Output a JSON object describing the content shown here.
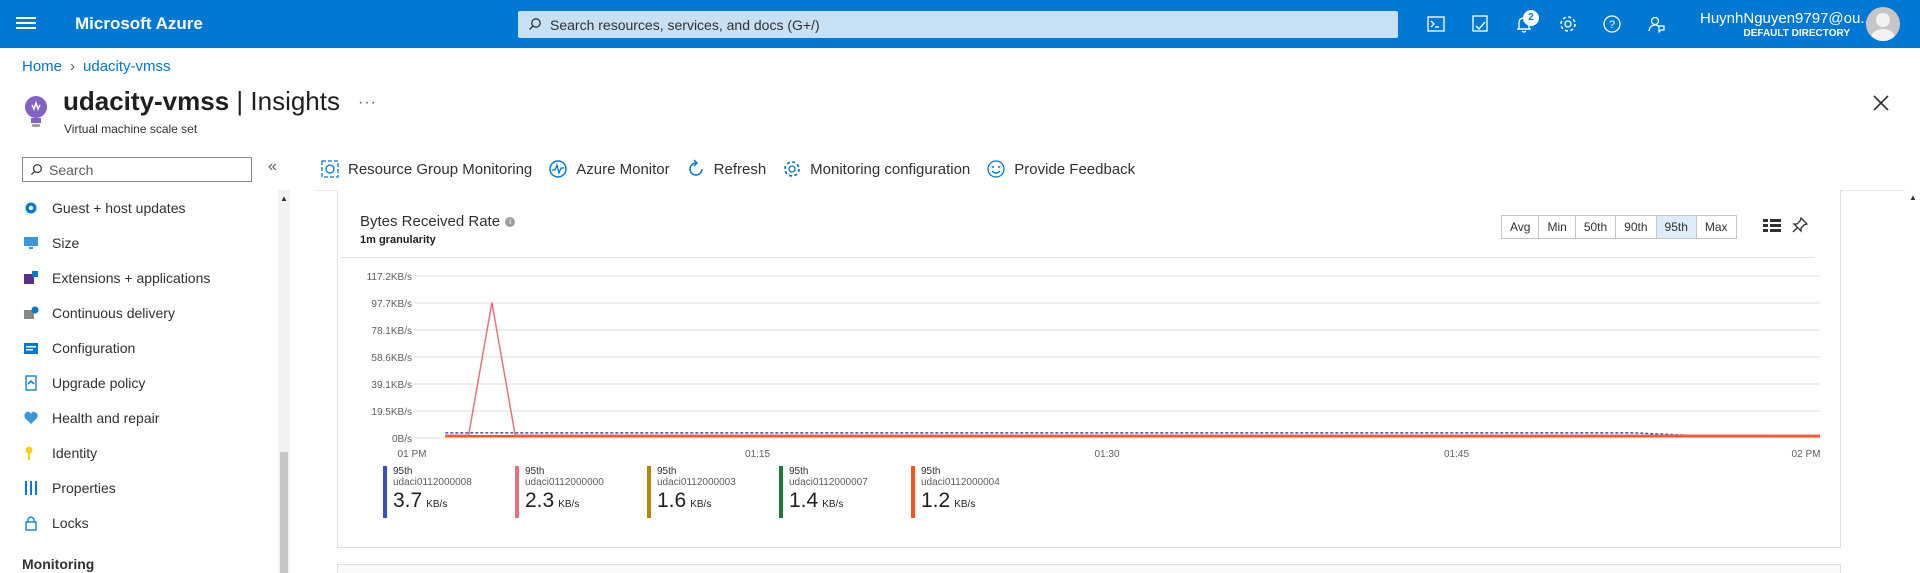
{
  "topbar": {
    "brand": "Microsoft Azure",
    "search_placeholder": "Search resources, services, and docs (G+/)",
    "notification_count": "2",
    "user_name": "HuynhNguyen9797@ou...",
    "directory": "DEFAULT DIRECTORY",
    "accent": "#0078d4"
  },
  "breadcrumb": {
    "home": "Home",
    "current": "udacity-vmss"
  },
  "page": {
    "resource_name": "udacity-vmss",
    "section": " | Insights",
    "subtitle": "Virtual machine scale set",
    "more": "···"
  },
  "sidebar": {
    "search_placeholder": "Search",
    "collapse": "«",
    "items": [
      {
        "label": "Guest + host updates",
        "icon": "gear-update-icon"
      },
      {
        "label": "Size",
        "icon": "monitor-icon"
      },
      {
        "label": "Extensions + applications",
        "icon": "extensions-icon"
      },
      {
        "label": "Continuous delivery",
        "icon": "delivery-icon"
      },
      {
        "label": "Configuration",
        "icon": "config-icon"
      },
      {
        "label": "Upgrade policy",
        "icon": "upgrade-icon"
      },
      {
        "label": "Health and repair",
        "icon": "health-icon"
      },
      {
        "label": "Identity",
        "icon": "key-icon"
      },
      {
        "label": "Properties",
        "icon": "properties-icon"
      },
      {
        "label": "Locks",
        "icon": "lock-icon"
      }
    ],
    "section_monitoring": "Monitoring"
  },
  "toolbar": {
    "resource_group_monitoring": "Resource Group Monitoring",
    "azure_monitor": "Azure Monitor",
    "refresh": "Refresh",
    "monitoring_configuration": "Monitoring configuration",
    "provide_feedback": "Provide Feedback"
  },
  "chart_panel": {
    "title": "Bytes Received Rate",
    "granularity": "1m granularity",
    "percentile_buttons": [
      "Avg",
      "Min",
      "50th",
      "90th",
      "95th",
      "Max"
    ],
    "selected_percentile": "95th"
  },
  "chart_data": {
    "type": "line",
    "title": "Bytes Received Rate",
    "xlabel": "",
    "ylabel": "",
    "x_ticks": [
      "01 PM",
      "01:15",
      "01:30",
      "01:45",
      "02 PM"
    ],
    "y_ticks": [
      "0B/s",
      "19.5KB/s",
      "39.1KB/s",
      "58.6KB/s",
      "78.1KB/s",
      "97.7KB/s",
      "117.2KB/s"
    ],
    "ylim": [
      0,
      117.2
    ],
    "y_unit": "KB/s",
    "x_minutes": [
      1,
      2,
      3,
      4,
      5,
      6,
      10,
      20,
      30,
      40,
      50,
      52,
      55,
      58,
      60
    ],
    "series": [
      {
        "name": "udaci0112000008",
        "color": "#3b4fc4",
        "values": [
          3.7,
          3.7,
          3.7,
          3.7,
          3.7,
          3.7,
          3.7,
          3.7,
          3.7,
          3.7,
          3.7,
          3.7,
          1.5,
          1.2,
          1.2
        ]
      },
      {
        "name": "udaci0112000000",
        "color": "#e8707e",
        "values": [
          2.0,
          2.0,
          98.0,
          2.0,
          2.0,
          2.0,
          2.0,
          2.0,
          2.0,
          2.0,
          2.0,
          2.0,
          2.0,
          2.0,
          2.0
        ]
      },
      {
        "name": "udaci0112000003",
        "color": "#b8860b",
        "values": [
          1.6,
          1.6,
          1.6,
          1.6,
          1.6,
          1.6,
          1.6,
          1.6,
          1.6,
          1.6,
          1.6,
          1.6,
          1.6,
          1.6,
          1.6
        ]
      },
      {
        "name": "udaci0112000007",
        "color": "#1e7a3c",
        "values": [
          1.4,
          1.4,
          1.4,
          1.4,
          1.4,
          1.4,
          1.4,
          1.4,
          1.4,
          1.4,
          1.4,
          1.4,
          1.4,
          1.4,
          1.4
        ]
      },
      {
        "name": "udaci0112000004",
        "color": "#f7541b",
        "values": [
          1.2,
          1.2,
          1.2,
          1.2,
          1.2,
          1.2,
          1.2,
          1.2,
          1.2,
          1.2,
          1.2,
          1.2,
          1.2,
          1.2,
          1.2
        ]
      }
    ],
    "grid": true
  },
  "legend": [
    {
      "percentile": "95th",
      "name": "udaci0112000008",
      "value": "3.7",
      "unit": "KB/s",
      "color": "#3b4fc4"
    },
    {
      "percentile": "95th",
      "name": "udaci0112000000",
      "value": "2.3",
      "unit": "KB/s",
      "color": "#e8707e"
    },
    {
      "percentile": "95th",
      "name": "udaci0112000003",
      "value": "1.6",
      "unit": "KB/s",
      "color": "#b8860b"
    },
    {
      "percentile": "95th",
      "name": "udaci0112000007",
      "value": "1.4",
      "unit": "KB/s",
      "color": "#1e7a3c"
    },
    {
      "percentile": "95th",
      "name": "udaci0112000004",
      "value": "1.2",
      "unit": "KB/s",
      "color": "#f7541b"
    }
  ]
}
